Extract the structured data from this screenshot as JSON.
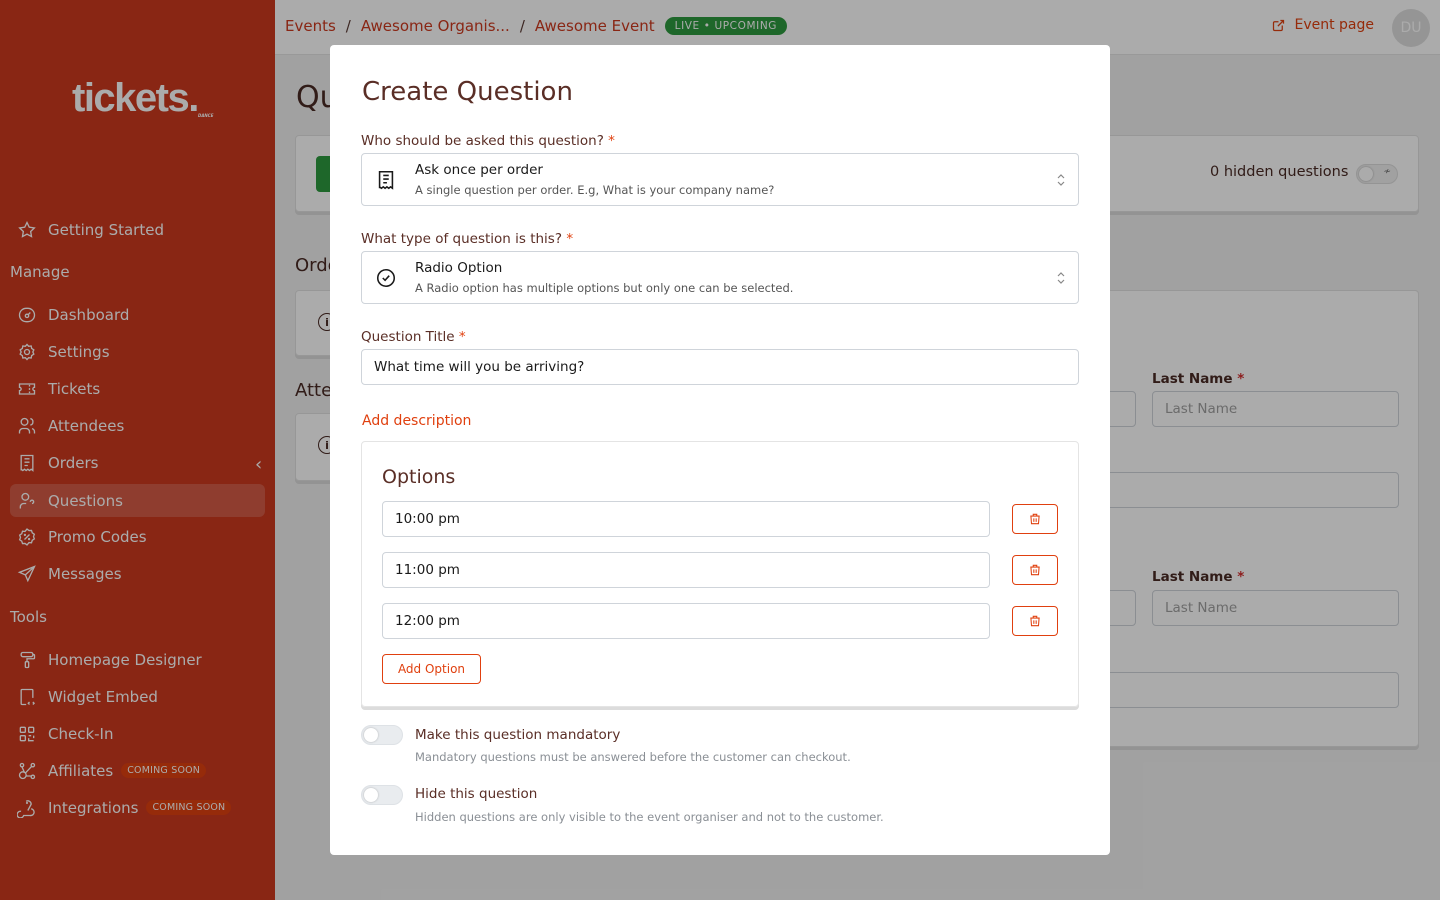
{
  "brand": {
    "logo_text": "tickets.",
    "logo_sub": "DANCE"
  },
  "sidebar": {
    "getting_started": "Getting Started",
    "manage_title": "Manage",
    "manage_items": [
      {
        "label": "Dashboard",
        "icon": "gauge-icon"
      },
      {
        "label": "Settings",
        "icon": "gear-icon"
      },
      {
        "label": "Tickets",
        "icon": "ticket-icon"
      },
      {
        "label": "Attendees",
        "icon": "users-icon"
      },
      {
        "label": "Orders",
        "icon": "receipt-icon"
      },
      {
        "label": "Questions",
        "icon": "user-question-icon",
        "active": true
      },
      {
        "label": "Promo Codes",
        "icon": "discount-icon"
      },
      {
        "label": "Messages",
        "icon": "send-icon"
      }
    ],
    "tools_title": "Tools",
    "tools_items": [
      {
        "label": "Homepage Designer",
        "icon": "paint-roller-icon"
      },
      {
        "label": "Widget Embed",
        "icon": "code-device-icon"
      },
      {
        "label": "Check-In",
        "icon": "qrcode-icon"
      },
      {
        "label": "Affiliates",
        "icon": "affiliate-icon",
        "badge": "COMING SOON"
      },
      {
        "label": "Integrations",
        "icon": "webhook-icon",
        "badge": "COMING SOON"
      }
    ]
  },
  "topbar": {
    "breadcrumbs": [
      "Events",
      "Awesome Organis...",
      "Awesome Event"
    ],
    "separator": "/",
    "status_badge": "LIVE • UPCOMING",
    "event_page_label": "Event page",
    "avatar_initials": "DU"
  },
  "background": {
    "page_title": "Questions",
    "hidden_questions": "0 hidden questions",
    "order_section": "Order Questions",
    "attendee_section": "Attendee Questions",
    "last_name_label": "Last Name",
    "last_name_placeholder": "Last Name"
  },
  "modal": {
    "title": "Create Question",
    "who_label": "Who should be asked this question?",
    "who_value": {
      "title": "Ask once per order",
      "description": "A single question per order. E.g, What is your company name?"
    },
    "type_label": "What type of question is this?",
    "type_value": {
      "title": "Radio Option",
      "description": "A Radio option has multiple options but only one can be selected."
    },
    "title_label": "Question Title",
    "title_value": "What time will you be arriving?",
    "add_description": "Add description",
    "options_title": "Options",
    "options": [
      "10:00 pm",
      "11:00 pm",
      "12:00 pm"
    ],
    "add_option": "Add Option",
    "mandatory": {
      "label": "Make this question mandatory",
      "description": "Mandatory questions must be answered before the customer can checkout.",
      "checked": false
    },
    "hidden": {
      "label": "Hide this question",
      "description": "Hidden questions are only visible to the event organiser and not to the customer.",
      "checked": false
    },
    "required_mark": "*"
  },
  "colors": {
    "brand": "#cd391e",
    "accent": "#e0400f",
    "live": "#2e9a3f"
  }
}
